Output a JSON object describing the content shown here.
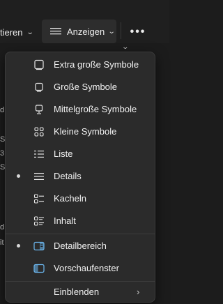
{
  "toolbar": {
    "sort_label": "tieren",
    "view_label": "Anzeigen",
    "more_label": "•••"
  },
  "background_fragments": [
    "d",
    "S",
    "3",
    "Se",
    "d",
    "it"
  ],
  "view_menu": {
    "items": [
      {
        "label": "Extra große Symbole",
        "icon": "monitor-large-icon",
        "selected": false
      },
      {
        "label": "Große Symbole",
        "icon": "monitor-icon",
        "selected": false
      },
      {
        "label": "Mittelgroße Symbole",
        "icon": "monitor-medium-icon",
        "selected": false
      },
      {
        "label": "Kleine Symbole",
        "icon": "small-icons-grid-icon",
        "selected": false
      },
      {
        "label": "Liste",
        "icon": "list-icon",
        "selected": false
      },
      {
        "label": "Details",
        "icon": "details-lines-icon",
        "selected": true
      },
      {
        "label": "Kacheln",
        "icon": "tiles-icon",
        "selected": false
      },
      {
        "label": "Inhalt",
        "icon": "content-icon",
        "selected": false
      }
    ],
    "pane_items": [
      {
        "label": "Detailbereich",
        "icon": "details-pane-icon",
        "selected": true
      },
      {
        "label": "Vorschaufenster",
        "icon": "preview-pane-icon",
        "selected": false
      }
    ],
    "show_item": {
      "label": "Einblenden",
      "icon": "chevron-right-icon"
    }
  },
  "colors": {
    "accent_icon": "#6cb8f0",
    "menu_bg": "#2b2b2b",
    "page_bg": "#1c1c1c"
  }
}
